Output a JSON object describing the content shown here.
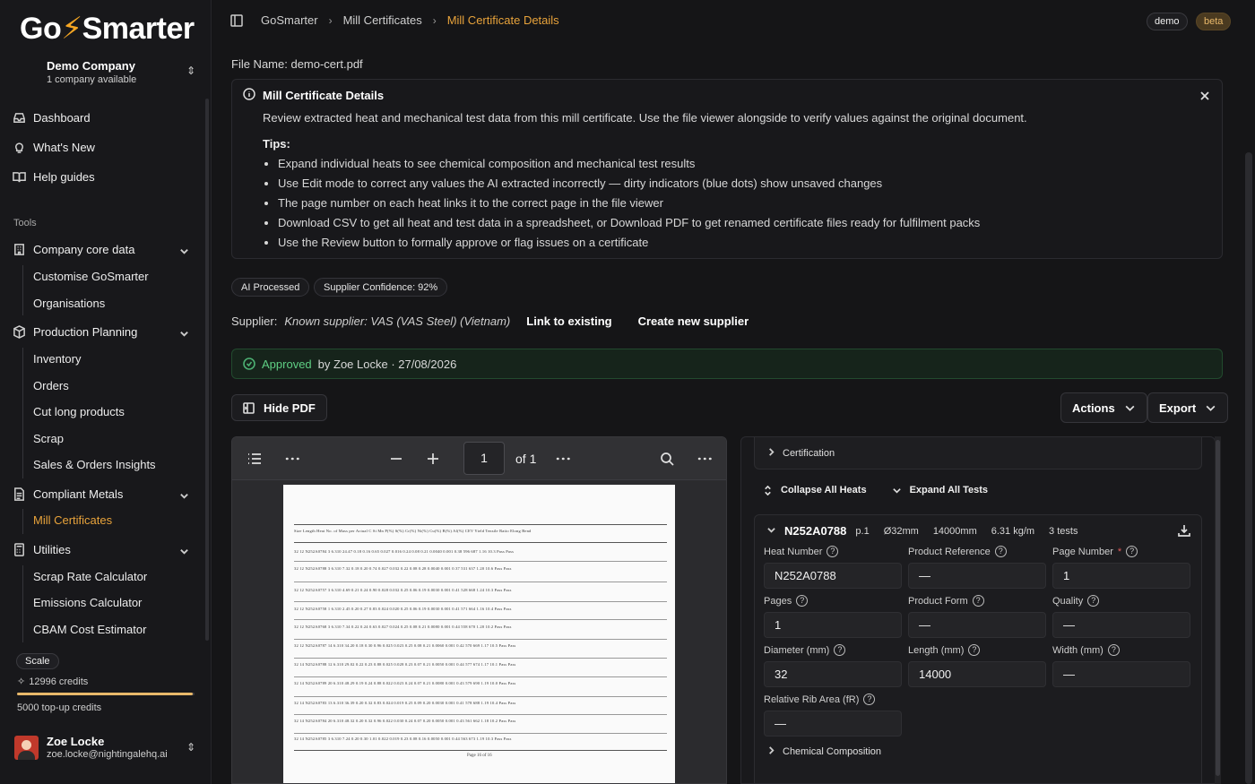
{
  "brand": {
    "logo_left": "Go",
    "logo_bolt": "⚡",
    "logo_right": "Smarter"
  },
  "company": {
    "name": "Demo Company",
    "sub": "1 company available"
  },
  "nav": {
    "dashboard": "Dashboard",
    "whats_new": "What's New",
    "help": "Help guides"
  },
  "tools_label": "Tools",
  "groups": {
    "company_core": "Company core data",
    "customise": "Customise GoSmarter",
    "organisations": "Organisations",
    "production": "Production Planning",
    "inventory": "Inventory",
    "orders": "Orders",
    "cut_long": "Cut long products",
    "scrap": "Scrap",
    "sales_insights": "Sales & Orders Insights",
    "compliant": "Compliant Metals",
    "mill_certs": "Mill Certificates",
    "utilities": "Utilities",
    "scrap_rate": "Scrap Rate Calculator",
    "emissions": "Emissions Calculator",
    "cbam": "CBAM Cost Estimator"
  },
  "plan": {
    "scale": "Scale",
    "credits": "12996 credits",
    "credit_fraction": 0.99,
    "topup": "5000 top-up credits"
  },
  "user": {
    "name": "Zoe Locke",
    "email": "zoe.locke@nightingalehq.ai"
  },
  "breadcrumb": {
    "root": "GoSmarter",
    "parent": "Mill Certificates",
    "current": "Mill Certificate Details"
  },
  "pills": {
    "demo": "demo",
    "beta": "beta"
  },
  "file_name": "File Name: demo-cert.pdf",
  "info": {
    "title": "Mill Certificate Details",
    "desc": "Review extracted heat and mechanical test data from this mill certificate. Use the file viewer alongside to verify values against the original document.",
    "tips_heading": "Tips:",
    "tips": [
      "Expand individual heats to see chemical composition and mechanical test results",
      "Use Edit mode to correct any values the AI extracted incorrectly — dirty indicators (blue dots) show unsaved changes",
      "The page number on each heat links it to the correct page in the file viewer",
      "Download CSV to get all heat and test data in a spreadsheet, or Download PDF to get renamed certificate files ready for fulfilment packs",
      "Use the Review button to formally approve or flag issues on a certificate"
    ]
  },
  "badges": {
    "ai": "AI Processed",
    "confidence": "Supplier Confidence: 92%"
  },
  "supplier": {
    "label": "Supplier:",
    "value": "Known supplier: VAS (VAS Steel) (Vietnam)",
    "link": "Link to existing",
    "create": "Create new supplier"
  },
  "approval": {
    "status": "Approved",
    "by": "by Zoe Locke · 27/08/2026"
  },
  "actions": {
    "hide_pdf": "Hide PDF",
    "actions": "Actions",
    "export": "Export"
  },
  "pdf": {
    "page": "1",
    "of": "of 1",
    "footer": "Page 16 of 16"
  },
  "doc_rows": [
    "Size  Length  Heat    No. of  Mass per  Actual  C    Si   Mn   P(%)  S(%)  Cr(%)  Ni(%)  Cu(%)  B(%)  Al(%)  CEV  Yield  Tensile  Ratio  Elong  Bend",
    "32  12  N252A0784  3  6.310  24.47  0.18  0.16  0.65  0.027  0.016  0.24  0.08  0.21  0.0040  0.001  0.38  596  687  1.16  10.3  Pass  Pass",
    "32  12  N252A0788  3  6.310  7.32  0.18  0.20  0.74  0.027  0.032  0.22  0.08  0.28  0.0040  0.001  0.37  531  637  1.20  10.6  Pass  Pass",
    "32  12  N252A0757  3  6.310  4.69  0.21  0.24  0.90  0.028  0.032  0.25  0.06  0.19  0.0030  0.001  0.41  528  668  1.24  10.3  Pass  Pass",
    "32  12  N252A0758  1  6.310  2.45  0.20  0.27  0.83  0.024  0.020  0.25  0.06  0.19  0.0030  0.001  0.41  571  664  1.16  10.4  Pass  Pass",
    "32  12  N252A0768  3  6.310  7.34  0.22  0.24  0.63  0.027  0.024  0.25  0.08  0.21  0.0080  0.001  0.44  558  670  1.20  10.2  Pass  Pass",
    "32  12  N252A0787  14  6.310  34.20  0.18  0.30  0.96  0.025  0.023  0.25  0.08  0.21  0.0060  0.001  0.42  570  669  1.17  10.5  Pass  Pass",
    "32  14  N252A0788  12  6.310  29.02  0.22  0.23  0.88  0.025  0.028  0.23  0.07  0.21  0.0050  0.001  0.44  577  674  1.17  10.1  Pass  Pass",
    "32  14  N252A0789  20  6.310  48.29  0.19  0.24  0.88  0.022  0.023  0.24  0.07  0.21  0.0080  0.001  0.43  579  690  1.19  10.0  Pass  Pass",
    "32  14  N252A0783  13  6.310  36.39  0.20  0.32  0.83  0.024  0.019  0.25  0.09  0.20  0.0030  0.001  0.41  578  688  1.19  10.4  Pass  Pass",
    "32  14  N252A0784  20  6.310  48.32  0.20  0.32  0.96  0.022  0.030  0.24  0.07  0.20  0.0050  0.001  0.43  561  662  1.18  10.2  Pass  Pass",
    "32  14  N252A0785  3  6.310  7.24  0.20  0.30  1.01  0.022  0.019  0.23  0.08  0.16  0.0050  0.001  0.44  563  673  1.19  10.3  Pass  Pass"
  ],
  "right": {
    "certification": "Certification",
    "collapse_all": "Collapse All Heats",
    "expand_all": "Expand All Tests",
    "heat": {
      "number": "N252A0788",
      "page": "p.1",
      "diameter": "Ø32mm",
      "length": "14000mm",
      "mass": "6.31 kg/m",
      "tests": "3 tests"
    },
    "fields": {
      "heat_number_label": "Heat Number",
      "heat_number": "N252A0788",
      "product_ref_label": "Product Reference",
      "product_ref": "—",
      "page_number_label": "Page Number",
      "page_number": "1",
      "required": "*",
      "pages_label": "Pages",
      "pages": "1",
      "product_form_label": "Product Form",
      "product_form": "—",
      "quality_label": "Quality",
      "quality": "—",
      "diameter_label": "Diameter (mm)",
      "diameter": "32",
      "length_label": "Length (mm)",
      "length": "14000",
      "width_label": "Width (mm)",
      "width": "—",
      "rib_label": "Relative Rib Area (fR)",
      "rib": "—"
    },
    "chemical": "Chemical Composition"
  },
  "icon_help": "?"
}
